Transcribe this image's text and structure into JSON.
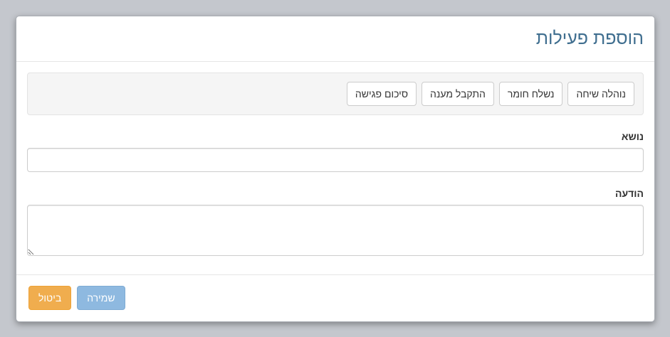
{
  "modal": {
    "title": "הוספת פעילות"
  },
  "quick_actions": [
    {
      "label": "נוהלה שיחה"
    },
    {
      "label": "נשלח חומר"
    },
    {
      "label": "התקבל מענה"
    },
    {
      "label": "סיכום פגישה"
    }
  ],
  "form": {
    "subject_label": "נושא",
    "subject_value": "",
    "message_label": "הודעה",
    "message_value": ""
  },
  "footer": {
    "cancel_label": "ביטול",
    "save_label": "שמירה"
  },
  "colors": {
    "title": "#3f6e8f",
    "cancel": "#f0ad4e",
    "save": "#8eb9e0"
  }
}
